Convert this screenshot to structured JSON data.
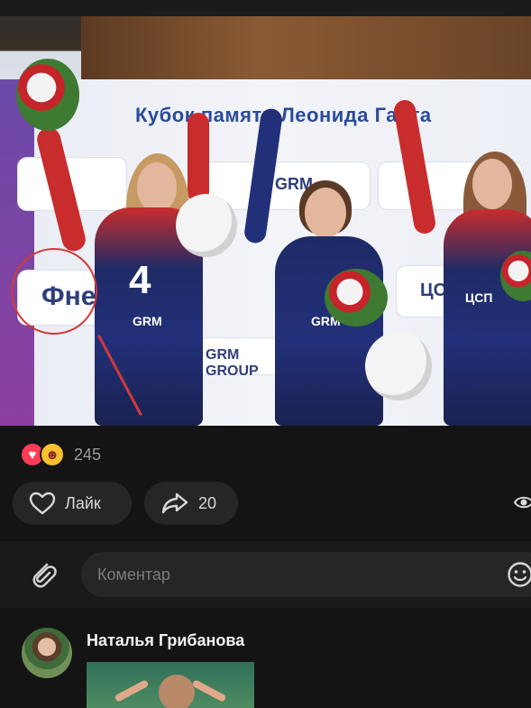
{
  "photo": {
    "banner_title": "Кубок памяти Леонида Гарта",
    "banner_logos": [
      "GRM",
      "ЦСП",
      "GRM GROUP"
    ],
    "circled_logo": "Фнерг",
    "athletes": [
      {
        "suit_number": "4",
        "suit_logo": "GRM"
      },
      {
        "suit_logo": "GRM"
      },
      {
        "suit_logo": "ЦСП"
      }
    ]
  },
  "reactions": {
    "count": "245"
  },
  "actions": {
    "like_label": "Лайк",
    "share_count": "20"
  },
  "comment_input": {
    "placeholder": "Коментар"
  },
  "comments": [
    {
      "author": "Наталья Грибанова"
    }
  ],
  "colors": {
    "background": "#141414",
    "pill": "#262626",
    "accent_red": "#d23a3a",
    "heart": "#ff3b57"
  }
}
